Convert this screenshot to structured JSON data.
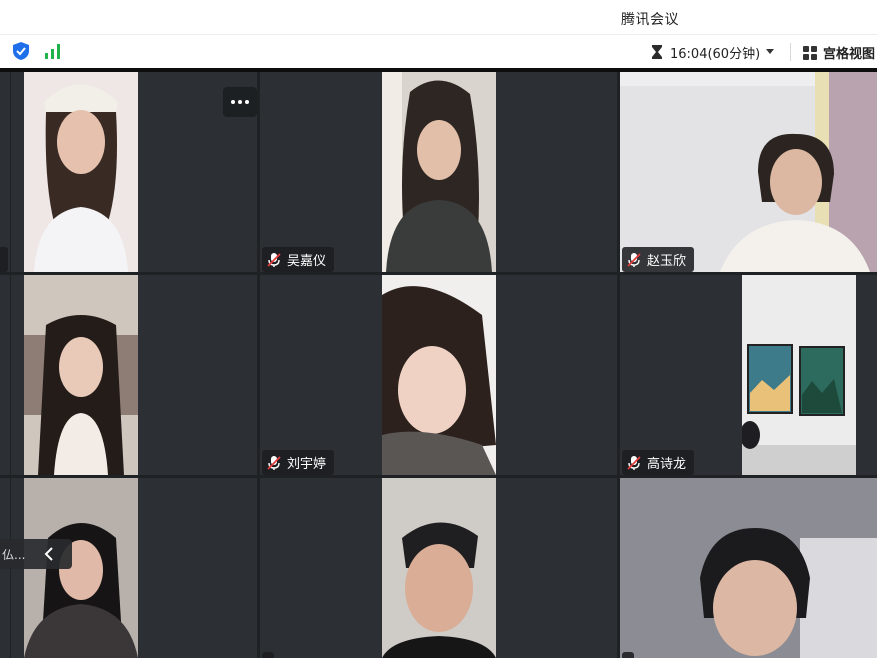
{
  "window": {
    "title": "腾讯会议"
  },
  "toolbar": {
    "shield_icon": "shield-check-icon",
    "signal_icon": "signal-bars-icon",
    "timer_text": "16:04(60分钟)",
    "view_label": "宫格视图"
  },
  "participants": [
    {
      "id": "p1",
      "name": "",
      "muted": false
    },
    {
      "id": "p2",
      "name": "吴嘉仪",
      "muted": true
    },
    {
      "id": "p3",
      "name": "赵玉欣",
      "muted": true
    },
    {
      "id": "p4",
      "name": "",
      "muted": false
    },
    {
      "id": "p5",
      "name": "刘宇婷",
      "muted": true
    },
    {
      "id": "p6",
      "name": "高诗龙",
      "muted": true
    },
    {
      "id": "p7",
      "name": "",
      "muted": false
    },
    {
      "id": "p8",
      "name": "",
      "muted": true
    },
    {
      "id": "p9",
      "name": "",
      "muted": true
    }
  ],
  "overlay": {
    "more_glyph": "•••",
    "chip_text": "仏..."
  },
  "colors": {
    "tile_bg": "#2c2f33",
    "app_bg": "#1f2225",
    "shield_blue": "#1f6feb",
    "signal_green": "#21b24b",
    "mic_muted_red": "#e23b3b"
  }
}
